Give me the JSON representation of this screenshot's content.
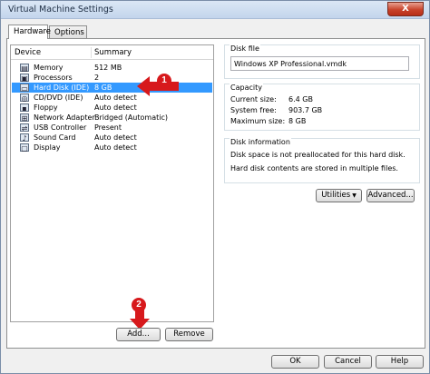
{
  "window": {
    "title": "Virtual Machine Settings",
    "close_label": "X"
  },
  "tabs": [
    {
      "label": "Hardware",
      "active": true
    },
    {
      "label": "Options",
      "active": false
    }
  ],
  "device_list": {
    "columns": [
      "Device",
      "Summary"
    ],
    "rows": [
      {
        "icon": "memory-icon",
        "glyph": "▤",
        "name": "Memory",
        "summary": "512 MB"
      },
      {
        "icon": "processor-icon",
        "glyph": "▣",
        "name": "Processors",
        "summary": "2"
      },
      {
        "icon": "hard-disk-icon",
        "glyph": "▭",
        "name": "Hard Disk (IDE)",
        "summary": "8 GB",
        "selected": true
      },
      {
        "icon": "cd-dvd-icon",
        "glyph": "◎",
        "name": "CD/DVD (IDE)",
        "summary": "Auto detect"
      },
      {
        "icon": "floppy-icon",
        "glyph": "▪",
        "name": "Floppy",
        "summary": "Auto detect"
      },
      {
        "icon": "network-adapter-icon",
        "glyph": "⊞",
        "name": "Network Adapter",
        "summary": "Bridged (Automatic)"
      },
      {
        "icon": "usb-controller-icon",
        "glyph": "⇌",
        "name": "USB Controller",
        "summary": "Present"
      },
      {
        "icon": "sound-card-icon",
        "glyph": "♪",
        "name": "Sound Card",
        "summary": "Auto detect"
      },
      {
        "icon": "display-icon",
        "glyph": "▢",
        "name": "Display",
        "summary": "Auto detect"
      }
    ]
  },
  "buttons": {
    "add": "Add...",
    "remove": "Remove",
    "utilities": "Utilities",
    "advanced": "Advanced...",
    "ok": "OK",
    "cancel": "Cancel",
    "help": "Help"
  },
  "disk_file": {
    "group_label": "Disk file",
    "value": "Windows XP Professional.vmdk"
  },
  "capacity": {
    "group_label": "Capacity",
    "rows": [
      {
        "label": "Current size:",
        "value": "6.4 GB"
      },
      {
        "label": "System free:",
        "value": "903.7 GB"
      },
      {
        "label": "Maximum size:",
        "value": "8 GB"
      }
    ]
  },
  "disk_information": {
    "group_label": "Disk information",
    "lines": [
      "Disk space is not preallocated for this hard disk.",
      "Hard disk contents are stored in multiple files."
    ]
  },
  "annotations": {
    "step1": "1",
    "step2": "2",
    "arrow_color": "#d7191c"
  }
}
